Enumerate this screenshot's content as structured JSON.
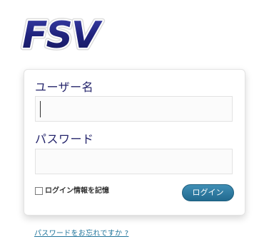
{
  "logo": {
    "text": "FSV"
  },
  "login_form": {
    "username_label": "ユーザー名",
    "username_value": "",
    "password_label": "パスワード",
    "password_value": "",
    "remember_label": "ログイン情報を記憶",
    "remember_checked": false,
    "submit_label": "ログイン"
  },
  "lost_password_link": "パスワードをお忘れですか ?",
  "colors": {
    "logo_navy": "#1e2178",
    "label_text": "#24246b",
    "button_blue": "#2f7ca5",
    "link_blue": "#21759b"
  }
}
